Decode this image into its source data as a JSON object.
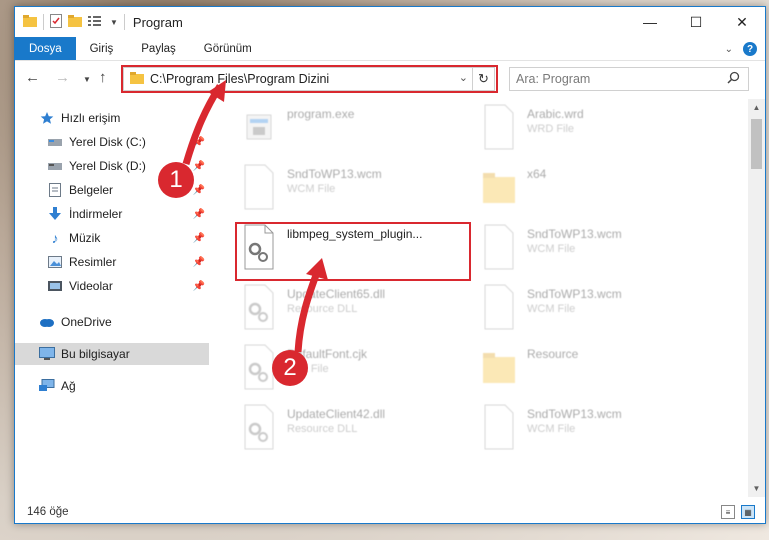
{
  "window": {
    "title": "Program"
  },
  "ribbon": {
    "tabs": [
      "Dosya",
      "Giriş",
      "Paylaş",
      "Görünüm"
    ]
  },
  "address": {
    "path": "C:\\Program Files\\Program Dizini"
  },
  "search": {
    "placeholder": "Ara: Program"
  },
  "sidebar": {
    "items": [
      {
        "label": "Hızlı erişim",
        "icon": "star-icon",
        "pinned": false
      },
      {
        "label": "Yerel Disk (C:)",
        "icon": "drive-icon",
        "pinned": true
      },
      {
        "label": "Yerel Disk (D:)",
        "icon": "drive-icon",
        "pinned": true
      },
      {
        "label": "Belgeler",
        "icon": "documents-icon",
        "pinned": true
      },
      {
        "label": "İndirmeler",
        "icon": "download-icon",
        "pinned": true
      },
      {
        "label": "Müzik",
        "icon": "music-icon",
        "pinned": true
      },
      {
        "label": "Resimler",
        "icon": "pictures-icon",
        "pinned": true
      },
      {
        "label": "Videolar",
        "icon": "videos-icon",
        "pinned": true
      },
      {
        "label": "OneDrive",
        "icon": "cloud-icon",
        "pinned": false
      },
      {
        "label": "Bu bilgisayar",
        "icon": "computer-icon",
        "pinned": false,
        "selected": true
      },
      {
        "label": "Ağ",
        "icon": "network-icon",
        "pinned": false
      }
    ]
  },
  "files": [
    {
      "name": "program.exe",
      "type": "",
      "icon": "exe-icon",
      "faded": true
    },
    {
      "name": "Arabic.wrd",
      "type": "WRD File",
      "icon": "file-icon",
      "faded": true
    },
    {
      "name": "SndToWP13.wcm",
      "type": "WCM File",
      "icon": "file-icon",
      "faded": true
    },
    {
      "name": "x64",
      "type": "",
      "icon": "folder-icon",
      "faded": true
    },
    {
      "name": "libmpeg_system_plugin...",
      "type": "",
      "icon": "dll-gear-icon",
      "faded": false
    },
    {
      "name": "SndToWP13.wcm",
      "type": "WCM File",
      "icon": "file-icon",
      "faded": true
    },
    {
      "name": "UpdateClient65.dll",
      "type": "Resource DLL",
      "icon": "dll-gear-icon",
      "faded": true
    },
    {
      "name": "SndToWP13.wcm",
      "type": "WCM File",
      "icon": "file-icon",
      "faded": true
    },
    {
      "name": "DefaultFont.cjk",
      "type": "CJK File",
      "icon": "dll-gear-icon",
      "faded": true
    },
    {
      "name": "Resource",
      "type": "",
      "icon": "folder-icon",
      "faded": true
    },
    {
      "name": "UpdateClient42.dll",
      "type": "Resource DLL",
      "icon": "dll-gear-icon",
      "faded": true
    },
    {
      "name": "SndToWP13.wcm",
      "type": "WCM File",
      "icon": "file-icon",
      "faded": true
    }
  ],
  "status": {
    "count": "146 öğe"
  },
  "callouts": [
    "1",
    "2"
  ],
  "colors": {
    "accent": "#1979ca",
    "highlight": "#d9282f"
  }
}
